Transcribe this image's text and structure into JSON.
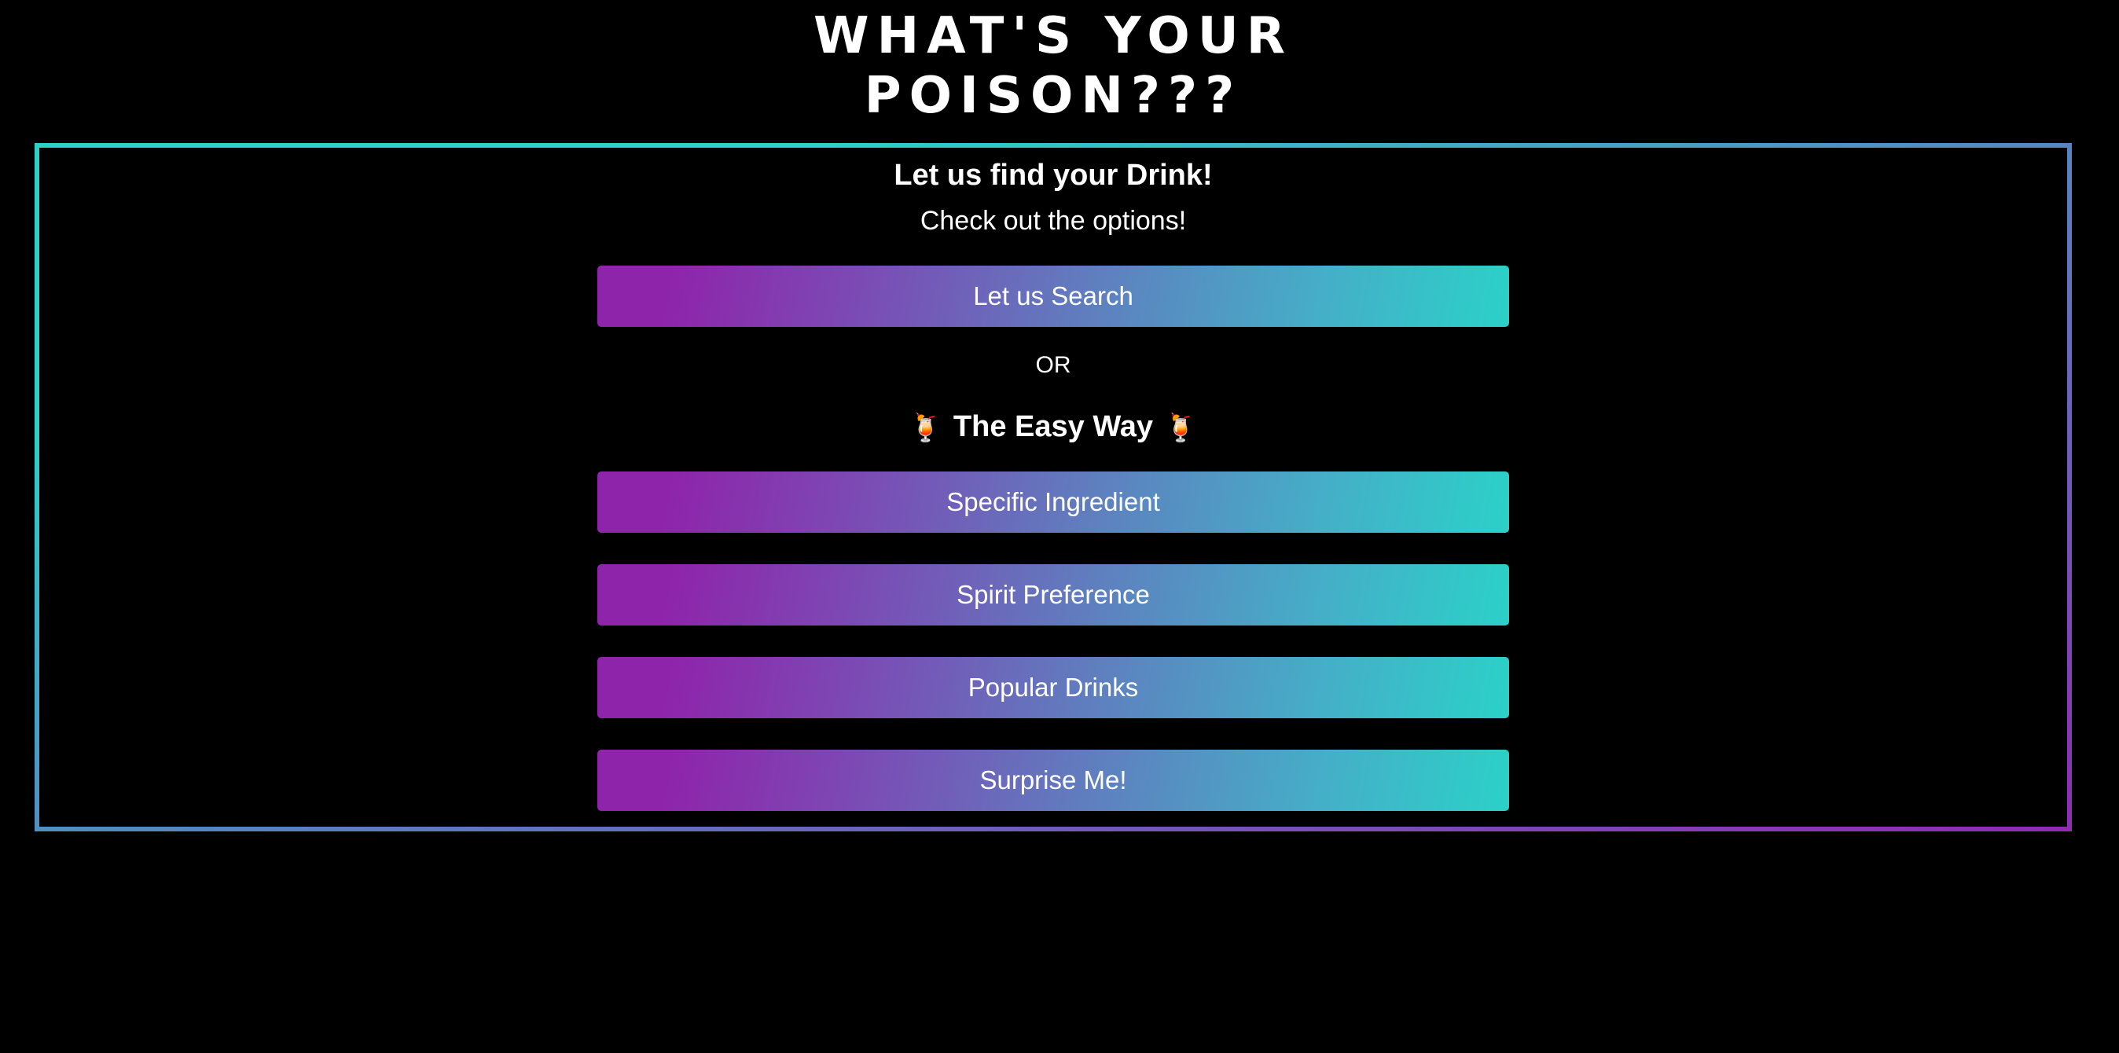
{
  "header": {
    "title_line1": "WHAT'S YOUR",
    "title_line2": "POISON???"
  },
  "panel": {
    "heading": "Let us find your Drink!",
    "subheading": "Check out the options!",
    "search_button": "Let us Search",
    "or_text": "OR",
    "easy_way_label": "The Easy Way",
    "easy_way_icon": "🍹",
    "options": [
      {
        "label": "Specific Ingredient"
      },
      {
        "label": "Spirit Preference"
      },
      {
        "label": "Popular Drinks"
      },
      {
        "label": "Surprise Me!"
      }
    ]
  },
  "colors": {
    "background": "#000000",
    "gradient_purple": "#8e24aa",
    "gradient_teal": "#2bd1c8",
    "text": "#ffffff"
  }
}
